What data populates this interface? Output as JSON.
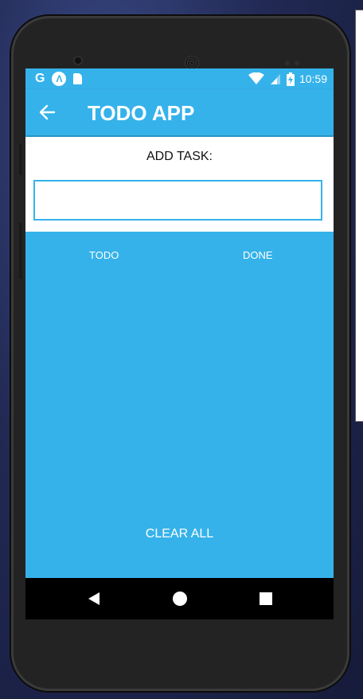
{
  "status_bar": {
    "left_icons": [
      "google-icon",
      "app-a-icon",
      "sd-card-icon"
    ],
    "google_glyph": "G",
    "app_glyph": "Λ",
    "right_icons": [
      "wifi-icon",
      "cellular-signal-icon",
      "battery-charging-icon"
    ],
    "time": "10:59"
  },
  "app_bar": {
    "back_icon": "arrow-left-icon",
    "title": "TODO APP"
  },
  "input_section": {
    "label": "ADD TASK:",
    "input_value": "",
    "input_placeholder": ""
  },
  "tabs": [
    {
      "label": "TODO"
    },
    {
      "label": "DONE"
    }
  ],
  "actions": {
    "clear_all": "CLEAR ALL"
  },
  "nav_bar": {
    "icons": [
      "back-triangle-icon",
      "home-circle-icon",
      "recents-square-icon"
    ]
  },
  "colors": {
    "primary": "#35b2ea",
    "surface": "#ffffff",
    "nav_bar": "#000000",
    "phone_body": "#232323"
  }
}
